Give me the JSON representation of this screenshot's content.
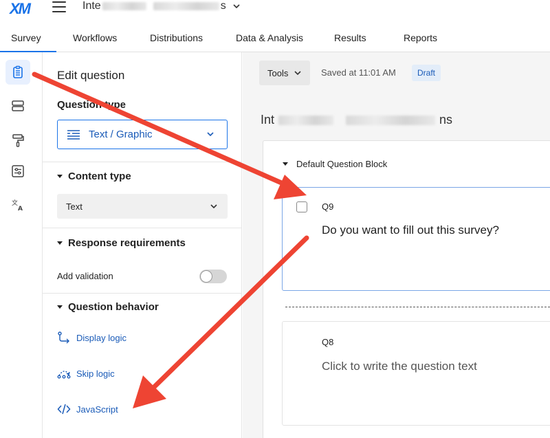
{
  "header": {
    "logo": "XM",
    "project_title_prefix": "Inte",
    "project_title_suffix": "s"
  },
  "tabs": [
    {
      "label": "Survey",
      "active": true
    },
    {
      "label": "Workflows"
    },
    {
      "label": "Distributions"
    },
    {
      "label": "Data & Analysis"
    },
    {
      "label": "Results"
    },
    {
      "label": "Reports"
    }
  ],
  "rail": {
    "icons": [
      "survey-clipboard-icon",
      "blocks-icon",
      "paint-roller-icon",
      "settings-sliders-icon",
      "translate-icon"
    ]
  },
  "panel": {
    "title": "Edit question",
    "question_type_label": "Question type",
    "question_type_value": "Text / Graphic",
    "content_type_label": "Content type",
    "content_type_value": "Text",
    "response_requirements_label": "Response requirements",
    "add_validation_label": "Add validation",
    "question_behavior_label": "Question behavior",
    "display_logic": "Display logic",
    "skip_logic": "Skip logic",
    "javascript": "JavaScript"
  },
  "toolbar": {
    "tools_label": "Tools",
    "saved_text": "Saved at 11:01 AM",
    "draft_label": "Draft"
  },
  "survey": {
    "title_prefix": "Int",
    "title_suffix": "ns",
    "block_name": "Default Question Block",
    "questions": [
      {
        "id": "Q9",
        "text": "Do you want to fill out this survey?"
      },
      {
        "id": "Q8",
        "text": "Click to write the question text"
      }
    ]
  },
  "colors": {
    "accent": "#1a73e8",
    "arrow": "#ee4433"
  }
}
